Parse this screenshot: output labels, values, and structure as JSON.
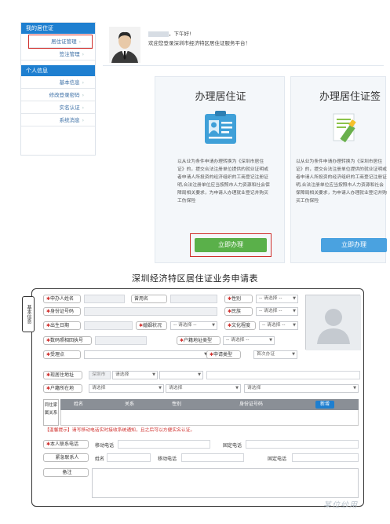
{
  "sidebar": {
    "section1": "我的居住证",
    "section1_items": [
      "居住证管理",
      "签注管理"
    ],
    "section2": "个人信息",
    "section2_items": [
      "基本信息",
      "修改登录密码",
      "实名认证",
      "系统消息"
    ]
  },
  "welcome": {
    "name_masked": "",
    "greeting_suffix": "，下午好!",
    "message": "欢迎您登录深圳市经济特区居住证服务平台！"
  },
  "cards": [
    {
      "title": "办理居住证",
      "description": "以从业为条件申请办理转换为《深圳市居住证》的，提交合法注册单位提供的就业证明或者申请人所投资的经济组织的工商登记注册证明,合法注册单位应当按照市人力资源和社会保障局相关要求，为申请人办理就业登记并购买工伤保险",
      "button": "立即办理"
    },
    {
      "title": "办理居住证签",
      "description": "以从业为条件申请办理转换为《深圳市居住证》的，提交合法注册单位提供的就业证明或者申请人所投资的经济组织的工商登记注册证明,合法注册单位应当按照市人力资源和社会保障局相关要求，为申请人办理就业登记并购买工伤保险",
      "button": "立即办理"
    }
  ],
  "form": {
    "title": "深圳经济特区居住证业务申请表",
    "section_basic": "基本信息",
    "labels": {
      "applicant_name": "申办人姓名",
      "used_name": "曾用名",
      "gender": "性别",
      "id_number": "身份证号码",
      "ethnicity": "民族",
      "birth_date": "出生日期",
      "marital": "婚姻状况",
      "education": "文化程度",
      "photo_receipt": "数码照相回执号",
      "hukou_type": "户籍地址类型",
      "accept_point": "受理点",
      "apply_type": "申请类型",
      "current_address": "现居住地址",
      "hukou_address": "户籍所在地",
      "family": "同住家属关系",
      "contact_phone": "本人联系电话",
      "emergency": "紧急联系人",
      "remarks": "备注"
    },
    "select_placeholder": "-- 请选择 --",
    "choose": "请选择",
    "apply_type_value": "首次办证",
    "city": "深圳市",
    "family_columns": [
      "姓名",
      "关系",
      "性别",
      "身份证号码"
    ],
    "family_add": "新增",
    "warning": "【温馨提示】请写移动电话实时接收系统通知，且之后可以方便实名认证。",
    "mobile": "移动电话",
    "landline": "固定电话",
    "name_field": "姓名"
  },
  "watermark": "某位纱用",
  "colors": {
    "accent": "#1e7fd0",
    "button": "#4aa2e0",
    "highlight": "#d0302d"
  }
}
